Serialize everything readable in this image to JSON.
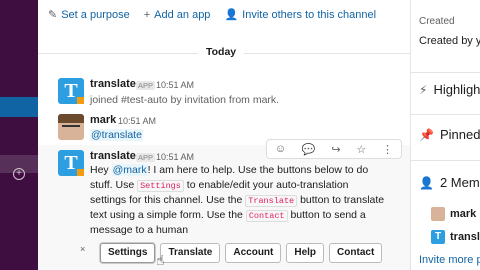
{
  "channel": {
    "actions": [
      {
        "icon": "pencil-icon",
        "label": "Set a purpose"
      },
      {
        "icon": "plus-icon",
        "label": "Add an app"
      },
      {
        "icon": "add-person-icon",
        "label": "Invite others to this channel"
      }
    ],
    "day_divider": "Today"
  },
  "messages": [
    {
      "name": "translate",
      "badge": "APP",
      "time": "10:51 AM",
      "text": "joined #test-auto by invitation from mark."
    },
    {
      "name": "mark",
      "time": "10:51 AM",
      "text": "@translate"
    },
    {
      "name": "translate",
      "badge": "APP",
      "time": "10:51 AM",
      "l1_a": "Hey ",
      "l1_mention": "@mark",
      "l1_b": "! I am here to help. Use the buttons below to do",
      "l2_a": "stuff. Use ",
      "l2_code": "Settings",
      "l2_b": " to enable/edit your auto-translation",
      "l3_a": "settings for this channel. Use the ",
      "l3_code": "Translate",
      "l3_b": " button to translate",
      "l4_a": "text using a simple form. Use the ",
      "l4_code": "Contact",
      "l4_b": " button to send a",
      "l5": "message to a human"
    }
  ],
  "buttons": [
    "Settings",
    "Translate",
    "Account",
    "Help",
    "Contact"
  ],
  "toolbar": [
    "reaction-icon",
    "thread-icon",
    "share-icon",
    "star-icon",
    "more-icon"
  ],
  "right_panel": {
    "created_label": "Created",
    "created_value": "Created by y",
    "highlights": "Highligh",
    "pinned": "Pinned",
    "members": "2 Memb",
    "member_1": "mark",
    "member_2": "transl",
    "invite_more": "Invite more p"
  }
}
